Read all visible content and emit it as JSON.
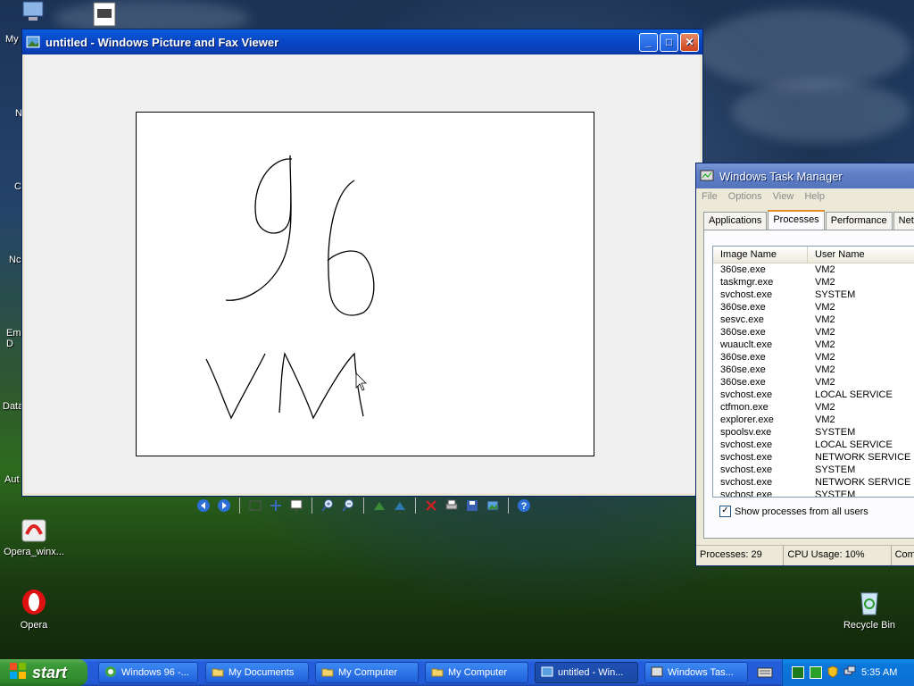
{
  "desktop": {
    "icons": [
      {
        "label": "Opera_winx...",
        "icon": "opera-installer-icon"
      },
      {
        "label": "Opera",
        "icon": "opera-icon"
      },
      {
        "label": "Recycle Bin",
        "icon": "recycle-bin-icon"
      }
    ],
    "edge_labels": [
      "My",
      "N",
      "C",
      "Nc",
      "Em\nD",
      "Data",
      "Aut"
    ]
  },
  "viewer": {
    "title": "untitled - Windows Picture and Fax Viewer",
    "image_alt": "handwritten 96 VM drawing",
    "toolbar": [
      "previous-image-icon",
      "next-image-icon",
      "best-fit-icon",
      "actual-size-icon",
      "slideshow-icon",
      "zoom-in-icon",
      "zoom-out-icon",
      "rotate-clockwise-icon",
      "rotate-counterclockwise-icon",
      "delete-icon",
      "print-icon",
      "save-icon",
      "edit-icon",
      "help-icon"
    ]
  },
  "taskmgr": {
    "title": "Windows Task Manager",
    "menu": [
      "File",
      "Options",
      "View",
      "Help"
    ],
    "tabs": [
      "Applications",
      "Processes",
      "Performance",
      "Netwo"
    ],
    "active_tab": "Processes",
    "columns": [
      "Image Name",
      "User Name"
    ],
    "rows": [
      [
        "360se.exe",
        "VM2"
      ],
      [
        "taskmgr.exe",
        "VM2"
      ],
      [
        "svchost.exe",
        "SYSTEM"
      ],
      [
        "360se.exe",
        "VM2"
      ],
      [
        "sesvc.exe",
        "VM2"
      ],
      [
        "360se.exe",
        "VM2"
      ],
      [
        "wuauclt.exe",
        "VM2"
      ],
      [
        "360se.exe",
        "VM2"
      ],
      [
        "360se.exe",
        "VM2"
      ],
      [
        "360se.exe",
        "VM2"
      ],
      [
        "svchost.exe",
        "LOCAL SERVICE"
      ],
      [
        "ctfmon.exe",
        "VM2"
      ],
      [
        "explorer.exe",
        "VM2"
      ],
      [
        "spoolsv.exe",
        "SYSTEM"
      ],
      [
        "svchost.exe",
        "LOCAL SERVICE"
      ],
      [
        "svchost.exe",
        "NETWORK SERVICE"
      ],
      [
        "svchost.exe",
        "SYSTEM"
      ],
      [
        "svchost.exe",
        "NETWORK SERVICE"
      ],
      [
        "svchost.exe",
        "SYSTEM"
      ]
    ],
    "show_all_label": "Show processes from all users",
    "show_all_checked": true,
    "status": {
      "processes": "Processes: 29",
      "cpu": "CPU Usage: 10%",
      "commit": "Comm"
    }
  },
  "taskbar": {
    "start_label": "start",
    "items": [
      {
        "label": "Windows 96 -...",
        "icon": "ie-icon"
      },
      {
        "label": "My Documents",
        "icon": "folder-icon"
      },
      {
        "label": "My Computer",
        "icon": "folder-icon"
      },
      {
        "label": "My Computer",
        "icon": "folder-icon"
      },
      {
        "label": "untitled - Win...",
        "icon": "picture-viewer-icon"
      },
      {
        "label": "Windows Tas...",
        "icon": "task-manager-icon"
      }
    ],
    "clock": "5:35 AM"
  },
  "colors": {
    "title_active": "#0a4fc8",
    "start_green": "#3c9a38",
    "taskbar_blue": "#245edb"
  }
}
